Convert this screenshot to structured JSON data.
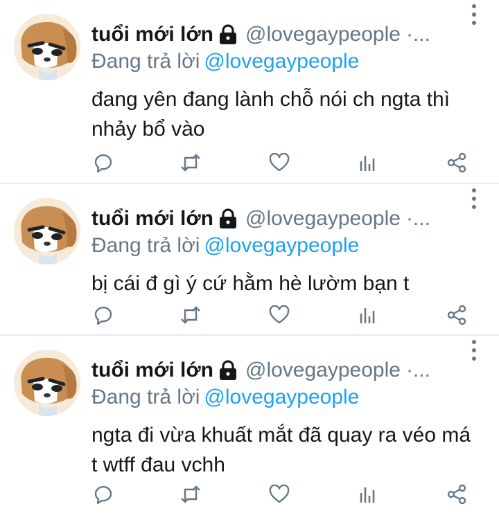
{
  "colors": {
    "text": "#14171a",
    "secondary": "#657786",
    "mention": "#1da1f2",
    "divider": "#e6ecf0"
  },
  "tweets": [
    {
      "display_name": "tuổi mới lớn",
      "handle": "@lovegaypeople",
      "handle_suffix": "·...",
      "reply_prefix": "Đang trả lời",
      "reply_mention": "@lovegaypeople",
      "text": "đang yên đang lành chỗ nói ch ngta thì nhảy bổ vào",
      "icons": [
        "lock-icon",
        "more-vertical-icon",
        "reply-icon",
        "retweet-icon",
        "like-icon",
        "analytics-icon",
        "share-icon"
      ]
    },
    {
      "display_name": "tuổi mới lớn",
      "handle": "@lovegaypeople",
      "handle_suffix": "·...",
      "reply_prefix": "Đang trả lời",
      "reply_mention": "@lovegaypeople",
      "text": "bị cái đ gì ý cứ hằm hè lườm bạn t",
      "icons": [
        "lock-icon",
        "more-vertical-icon",
        "reply-icon",
        "retweet-icon",
        "like-icon",
        "analytics-icon",
        "share-icon"
      ]
    },
    {
      "display_name": "tuổi mới lớn",
      "handle": "@lovegaypeople",
      "handle_suffix": "·...",
      "reply_prefix": "Đang trả lời",
      "reply_mention": "@lovegaypeople",
      "text": "ngta đi vừa khuất mắt đã quay ra véo má t wtff đau vchh",
      "icons": [
        "lock-icon",
        "more-vertical-icon",
        "reply-icon",
        "retweet-icon",
        "like-icon",
        "analytics-icon",
        "share-icon"
      ]
    }
  ]
}
